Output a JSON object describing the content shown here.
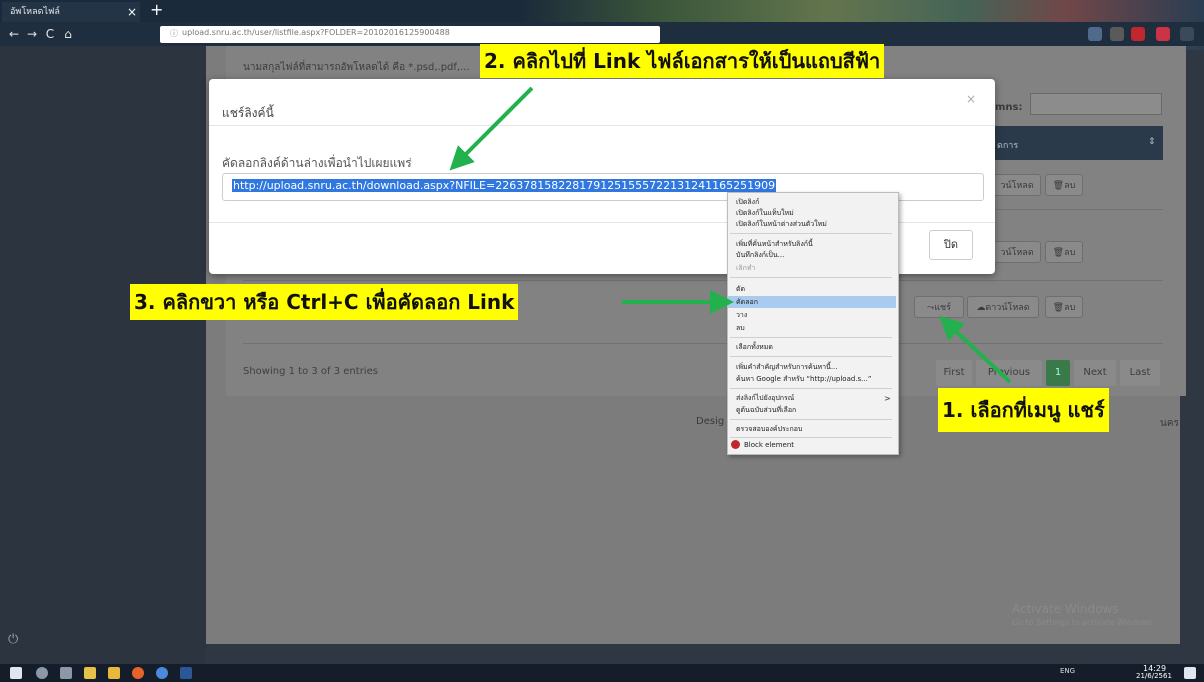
{
  "browser": {
    "tab_title": "อัพโหลดไฟล์",
    "tab_close": "×",
    "new_tab": "+",
    "back": "←",
    "forward": "→",
    "reload": "C",
    "home": "⌂",
    "url_info": "ⓘ",
    "url": "upload.snru.ac.th/user/listfile.aspx?FOLDER=20102016125900488"
  },
  "page": {
    "instruction": "นามสกุลไฟล์ที่สามารถอัพโหลดได้ คือ *.psd,.pdf,...",
    "columns_label": "mns:",
    "table_header": "ดการ",
    "sort_icon": "⇕",
    "rows": [
      {
        "share": "",
        "download": "วน์โหลด",
        "delete": "ลบ"
      },
      {
        "share": "",
        "download": "วน์โหลด",
        "delete": "ลบ"
      },
      {
        "share": "แชร์",
        "download": "ดาวน์โหลด",
        "delete": "ลบ"
      }
    ],
    "showing": "Showing 1 to 3 of 3 entries",
    "pagination": {
      "first": "First",
      "previous": "Previous",
      "current": "1",
      "next": "Next",
      "last": "Last"
    },
    "footer_left": "Desig",
    "footer_right": "นคร",
    "activate_title": "Activate Windows",
    "activate_sub": "Go to Settings to activate Windows."
  },
  "modal": {
    "title": "แชร์ลิงค์นี้",
    "close": "×",
    "label": "คัดลอกลิงค์ด้านล่างเพื่อนำไปเผยแพร่",
    "link": "http://upload.snru.ac.th/download.aspx?NFILE=22637815822817912515557221312411652519​09",
    "close_button": "ปิด"
  },
  "context_menu": {
    "items": [
      "เปิดลิงก์",
      "เปิดลิงก์ในแท็บใหม่",
      "เปิดลิงก์ในหน้าต่างส่วนตัวใหม่",
      "เพิ่มที่คั่นหน้าสำหรับลิงก์นี้",
      "บันทึกลิงก์เป็น...",
      "เลิกทำ",
      "ตัด",
      "คัดลอก",
      "วาง",
      "ลบ",
      "เลือกทั้งหมด",
      "เพิ่มคำสำคัญสำหรับการค้นหานี้...",
      "ค้นหา Google สำหรับ “http://upload.s...”",
      "ส่งลิงก์ไปยังอุปกรณ์",
      "ดูต้นฉบับส่วนที่เลือก",
      "ตรวจสอบองค์ประกอบ",
      "Block element"
    ],
    "submenu_arrow": ">"
  },
  "callouts": {
    "step1": "1. เลือกที่เมนู แชร์",
    "step2": "2. คลิกไปที่ Link ไฟล์เอกสารให้เป็นแถบสีฟ้า",
    "step3": "3. คลิกขวา หรือ Ctrl+C เพื่อคัดลอก Link"
  },
  "taskbar": {
    "tray": "ENG",
    "time": "14:29",
    "date": "21/6/2561"
  },
  "colors": {
    "callout_bg": "#ffff00",
    "arrow": "#22b14c",
    "selection": "#3078e0",
    "menu_highlight": "#a9cbee"
  }
}
